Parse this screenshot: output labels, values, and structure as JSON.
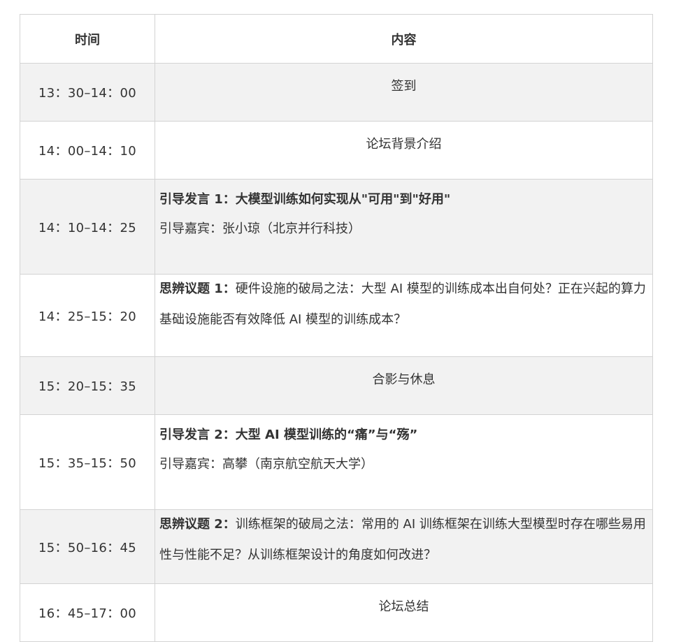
{
  "header": {
    "time": "时间",
    "content": "内容"
  },
  "rows": [
    {
      "time": "13：30–14：00",
      "title": "签到"
    },
    {
      "time": "14：00–14：10",
      "title": "论坛背景介绍"
    },
    {
      "time": "14：10–14：25",
      "title": "引导发言 1：大模型训练如何实现从\"可用\"到\"好用\"",
      "sub": "引导嘉宾：张小琼（北京并行科技）"
    },
    {
      "time": "14：25–15：20",
      "bold": "思辨议题 1：",
      "text": "硬件设施的破局之法：大型 AI 模型的训练成本出自何处？正在兴起的算力基础设施能否有效降低 AI 模型的训练成本？"
    },
    {
      "time": "15：20–15：35",
      "title": "合影与休息"
    },
    {
      "time": "15：35–15：50",
      "title": "引导发言 2：大型 AI 模型训练的“痛”与“殇”",
      "sub": "引导嘉宾：高攀（南京航空航天大学）"
    },
    {
      "time": "15：50–16：45",
      "bold": "思辨议题 2：",
      "text": "训练框架的破局之法：常用的 AI 训练框架在训练大型模型时存在哪些易用性与性能不足？从训练框架设计的角度如何改进？"
    },
    {
      "time": "16：45–17：00",
      "title": "论坛总结"
    }
  ]
}
